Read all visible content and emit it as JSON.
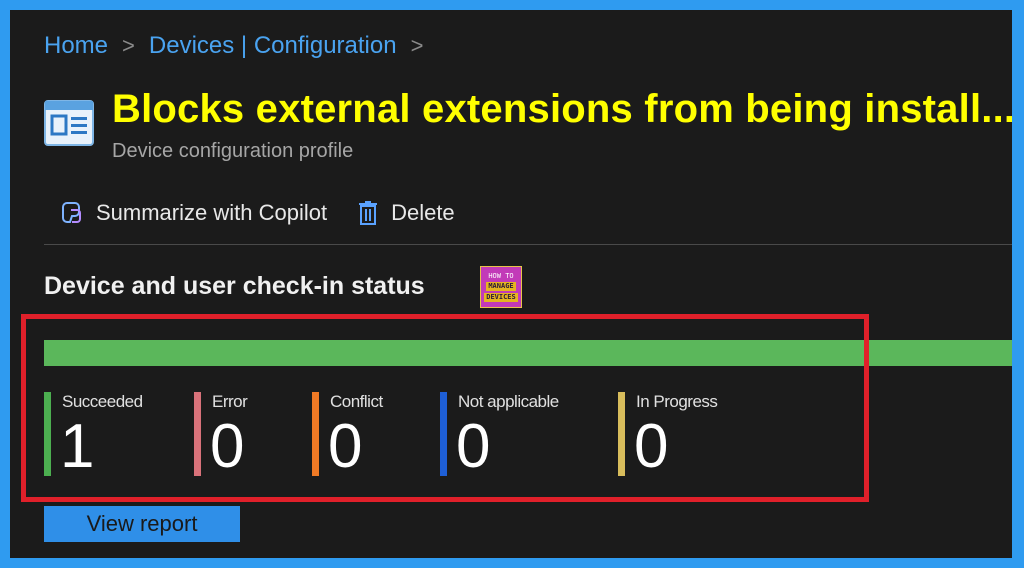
{
  "breadcrumb": {
    "items": [
      "Home",
      "Devices | Configuration"
    ],
    "separator": ">"
  },
  "header": {
    "title": "Blocks external extensions from being install...",
    "subtitle": "Device configuration profile",
    "icon": "configuration-profile-icon"
  },
  "toolbar": {
    "summarize_label": "Summarize with Copilot",
    "delete_label": "Delete"
  },
  "section": {
    "title": "Device and user check-in status"
  },
  "logo": {
    "lines": [
      "HOW TO",
      "MANAGE",
      "DEVICES"
    ]
  },
  "status": {
    "progress_succeeded_fraction": 1.0,
    "progress_color": "#5bb75b",
    "items": [
      {
        "label": "Succeeded",
        "value": "1",
        "color": "#4caf50"
      },
      {
        "label": "Error",
        "value": "0",
        "color": "#d9727a"
      },
      {
        "label": "Conflict",
        "value": "0",
        "color": "#f07a25"
      },
      {
        "label": "Not applicable",
        "value": "0",
        "color": "#1e5fd6"
      },
      {
        "label": "In Progress",
        "value": "0",
        "color": "#d8bd5c"
      }
    ]
  },
  "actions": {
    "view_report_label": "View report"
  },
  "colors": {
    "title": "#ffff00",
    "link": "#4aa3f0",
    "highlight_border": "#e0202a",
    "frame_border": "#2f9bf0"
  }
}
